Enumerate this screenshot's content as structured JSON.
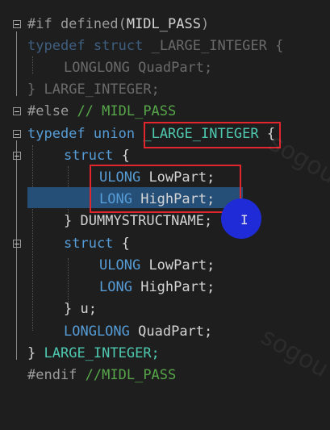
{
  "colors": {
    "background": "#1e1e1e",
    "keyword": "#569cd6",
    "type": "#4ec9b0",
    "identifier": "#d4d4d4",
    "comment": "#57a64a",
    "preprocessor": "#9b9b9b",
    "selection": "#264f78",
    "annotation_box": "#e2262e",
    "cursor_highlight": "#1f2bd6"
  },
  "code": {
    "l1_directive": "#if defined(",
    "l1_macro": "MIDL_PASS",
    "l1_close": ")",
    "l2_typedef": "typedef",
    "l2_struct": "struct",
    "l2_name": "_LARGE_INTEGER",
    "l2_brace": "{",
    "l3_type": "LONGLONG",
    "l3_field": "QuadPart;",
    "l4_close": "}",
    "l4_name": "LARGE_INTEGER;",
    "l5_directive": "#else",
    "l5_comment": "// MIDL_PASS",
    "l6_typedef": "typedef",
    "l6_union": "union",
    "l6_name": "_LARGE_INTEGER",
    "l6_brace": "{",
    "l7_struct": "struct",
    "l7_brace": "{",
    "l8_type": "ULONG",
    "l8_field": "LowPart;",
    "l9_type": "LONG",
    "l9_field": "HighPart;",
    "l10_close": "}",
    "l10_name": "DUMMYSTRUCTNAME;",
    "l11_struct": "struct",
    "l11_brace": "{",
    "l12_type": "ULONG",
    "l12_field": "LowPart;",
    "l13_type": "LONG",
    "l13_field": "HighPart;",
    "l14_close": "}",
    "l14_name": "u;",
    "l15_type": "LONGLONG",
    "l15_field": "QuadPart;",
    "l16_close": "}",
    "l16_name": "LARGE_INTEGER;",
    "l17_directive": "#endif",
    "l17_comment": "//MIDL_PASS"
  },
  "cursor": {
    "glyph": "I"
  },
  "watermark": "sogou"
}
